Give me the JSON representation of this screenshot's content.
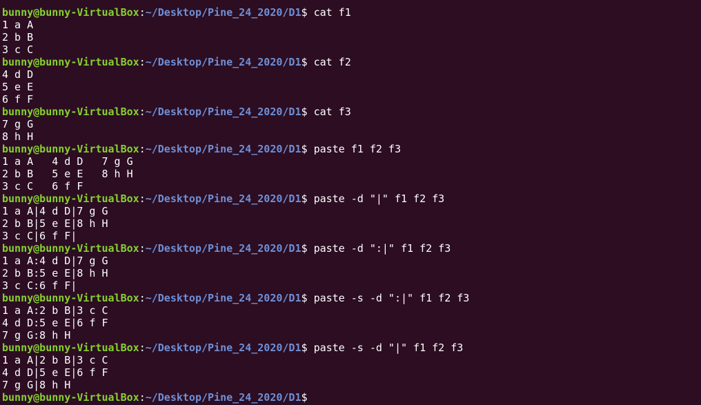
{
  "terminal": {
    "user_host": "bunny@bunny-VirtualBox",
    "path": "~/Desktop/Pine_24_2020/D1",
    "prompt_symbol": "$",
    "blocks": [
      {
        "command": "cat f1",
        "output": [
          "1 a A",
          "2 b B",
          "3 c C"
        ]
      },
      {
        "command": "cat f2",
        "output": [
          "4 d D",
          "5 e E",
          "6 f F"
        ]
      },
      {
        "command": "cat f3",
        "output": [
          "7 g G",
          "8 h H"
        ]
      },
      {
        "command": "paste f1 f2 f3",
        "output": [
          "1 a A\t4 d D\t7 g G",
          "2 b B\t5 e E\t8 h H",
          "3 c C\t6 f F"
        ]
      },
      {
        "command": "paste -d \"|\" f1 f2 f3",
        "output": [
          "1 a A|4 d D|7 g G",
          "2 b B|5 e E|8 h H",
          "3 c C|6 f F|"
        ]
      },
      {
        "command": "paste -d \":|\" f1 f2 f3",
        "output": [
          "1 a A:4 d D|7 g G",
          "2 b B:5 e E|8 h H",
          "3 c C:6 f F|"
        ]
      },
      {
        "command": "paste -s -d \":|\" f1 f2 f3",
        "output": [
          "1 a A:2 b B|3 c C",
          "4 d D:5 e E|6 f F",
          "7 g G:8 h H"
        ]
      },
      {
        "command": "paste -s -d \"|\" f1 f2 f3",
        "output": [
          "1 a A|2 b B|3 c C",
          "4 d D|5 e E|6 f F",
          "7 g G|8 h H"
        ]
      },
      {
        "command": "",
        "output": []
      }
    ]
  }
}
